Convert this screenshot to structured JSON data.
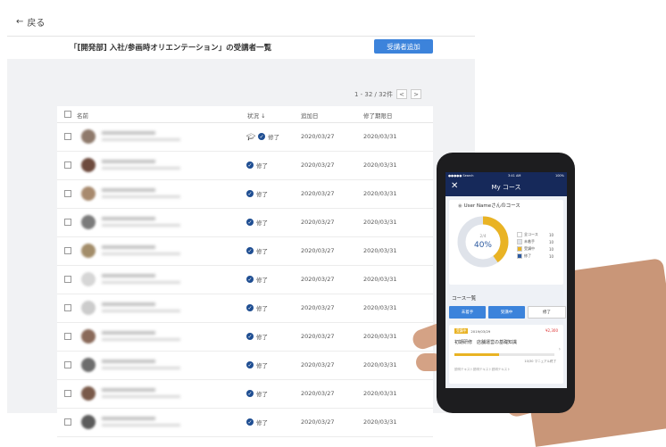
{
  "nav": {
    "back_label": "戻る",
    "back_icon": "arrow-left-icon"
  },
  "header": {
    "title": "「[開発部] 入社/参画時オリエンテーション」の受講者一覧",
    "add_button": "受講者追加",
    "accent": "#3c83db"
  },
  "pagination": {
    "range": "1 - 32 / 32件",
    "prev": "<",
    "next": ">"
  },
  "table": {
    "headers": {
      "name": "名前",
      "status": "状況 ↓",
      "added": "追加日",
      "due": "修了期限日"
    },
    "rows": [
      {
        "status": "修了",
        "added": "2020/03/27",
        "due": "2020/03/31",
        "avatar": "#8f7a6c",
        "cap": true
      },
      {
        "status": "修了",
        "added": "2020/03/27",
        "due": "2020/03/31",
        "avatar": "#6e4b3e",
        "cap": false
      },
      {
        "status": "修了",
        "added": "2020/03/27",
        "due": "2020/03/31",
        "avatar": "#a88a6e",
        "cap": false
      },
      {
        "status": "修了",
        "added": "2020/03/27",
        "due": "2020/03/31",
        "avatar": "#7b7b7b",
        "cap": false
      },
      {
        "status": "修了",
        "added": "2020/03/27",
        "due": "2020/03/31",
        "avatar": "#a38d6a",
        "cap": false
      },
      {
        "status": "修了",
        "added": "2020/03/27",
        "due": "2020/03/31",
        "avatar": "#d6d6d6",
        "cap": false
      },
      {
        "status": "修了",
        "added": "2020/03/27",
        "due": "2020/03/31",
        "avatar": "#cccccc",
        "cap": false
      },
      {
        "status": "修了",
        "added": "2020/03/27",
        "due": "2020/03/31",
        "avatar": "#8a6a5a",
        "cap": false
      },
      {
        "status": "修了",
        "added": "2020/03/27",
        "due": "2020/03/31",
        "avatar": "#6d6d6d",
        "cap": false
      },
      {
        "status": "修了",
        "added": "2020/03/27",
        "due": "2020/03/31",
        "avatar": "#7a5a4a",
        "cap": false
      },
      {
        "status": "修了",
        "added": "2020/03/27",
        "due": "2020/03/31",
        "avatar": "#5c5c5c",
        "cap": false
      }
    ]
  },
  "mobile": {
    "status_left": "●●●●● Search",
    "status_time": "3:41 AM",
    "status_right": "100%",
    "title": "My コース",
    "close": "✕",
    "user_course": "User Nameさんのコース",
    "donut_small": "2/4",
    "donut_percent": "40%",
    "donut_fraction": 0.4,
    "legend": [
      {
        "label": "全コース",
        "value": "10",
        "color": "#ffffff"
      },
      {
        "label": "未着手",
        "value": "10",
        "color": "#dfe3ea"
      },
      {
        "label": "受講中",
        "value": "10",
        "color": "#e9b324"
      },
      {
        "label": "修了",
        "value": "10",
        "color": "#2c5aa0"
      }
    ],
    "course_list_label": "コース一覧",
    "tabs": [
      "未着手",
      "受講中",
      "修了"
    ],
    "card_tag": "受講中",
    "card_date": "2019/03/29",
    "card_price": "¥2,300",
    "card_title": "初期研修　店舗運営の基礎知識",
    "card_progress": 0.45,
    "card_progress_text": "10/30 マニュアル終了",
    "card_note": "説明テキスト説明テキスト説明テキスト"
  }
}
